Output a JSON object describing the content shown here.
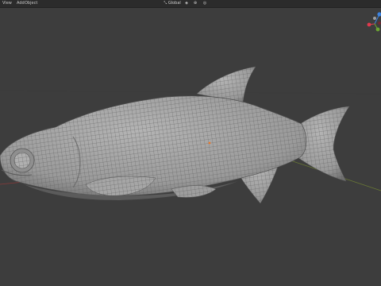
{
  "header": {
    "menus": [
      {
        "label": "View"
      },
      {
        "label": "Add"
      },
      {
        "label": "Object"
      }
    ],
    "orientation_label": "Global",
    "center_tools": [
      {
        "icon": "orientation-icon"
      },
      {
        "icon": "pivot-icon"
      },
      {
        "icon": "snap-icon"
      },
      {
        "icon": "proportional-editing-icon"
      }
    ]
  },
  "viewport": {
    "background": "#3d3d3d",
    "mesh_color": "#a9a9a9",
    "wire_color": "#5a5a5a",
    "x_axis_color": "#8a3a3a",
    "y_axis_color": "#6b7b35",
    "object_origin_color": "#e8782c",
    "gizmo_colors": {
      "x": "#e0394d",
      "y": "#6da532",
      "z": "#3d83e0",
      "dot": "#9e9e9e"
    }
  }
}
